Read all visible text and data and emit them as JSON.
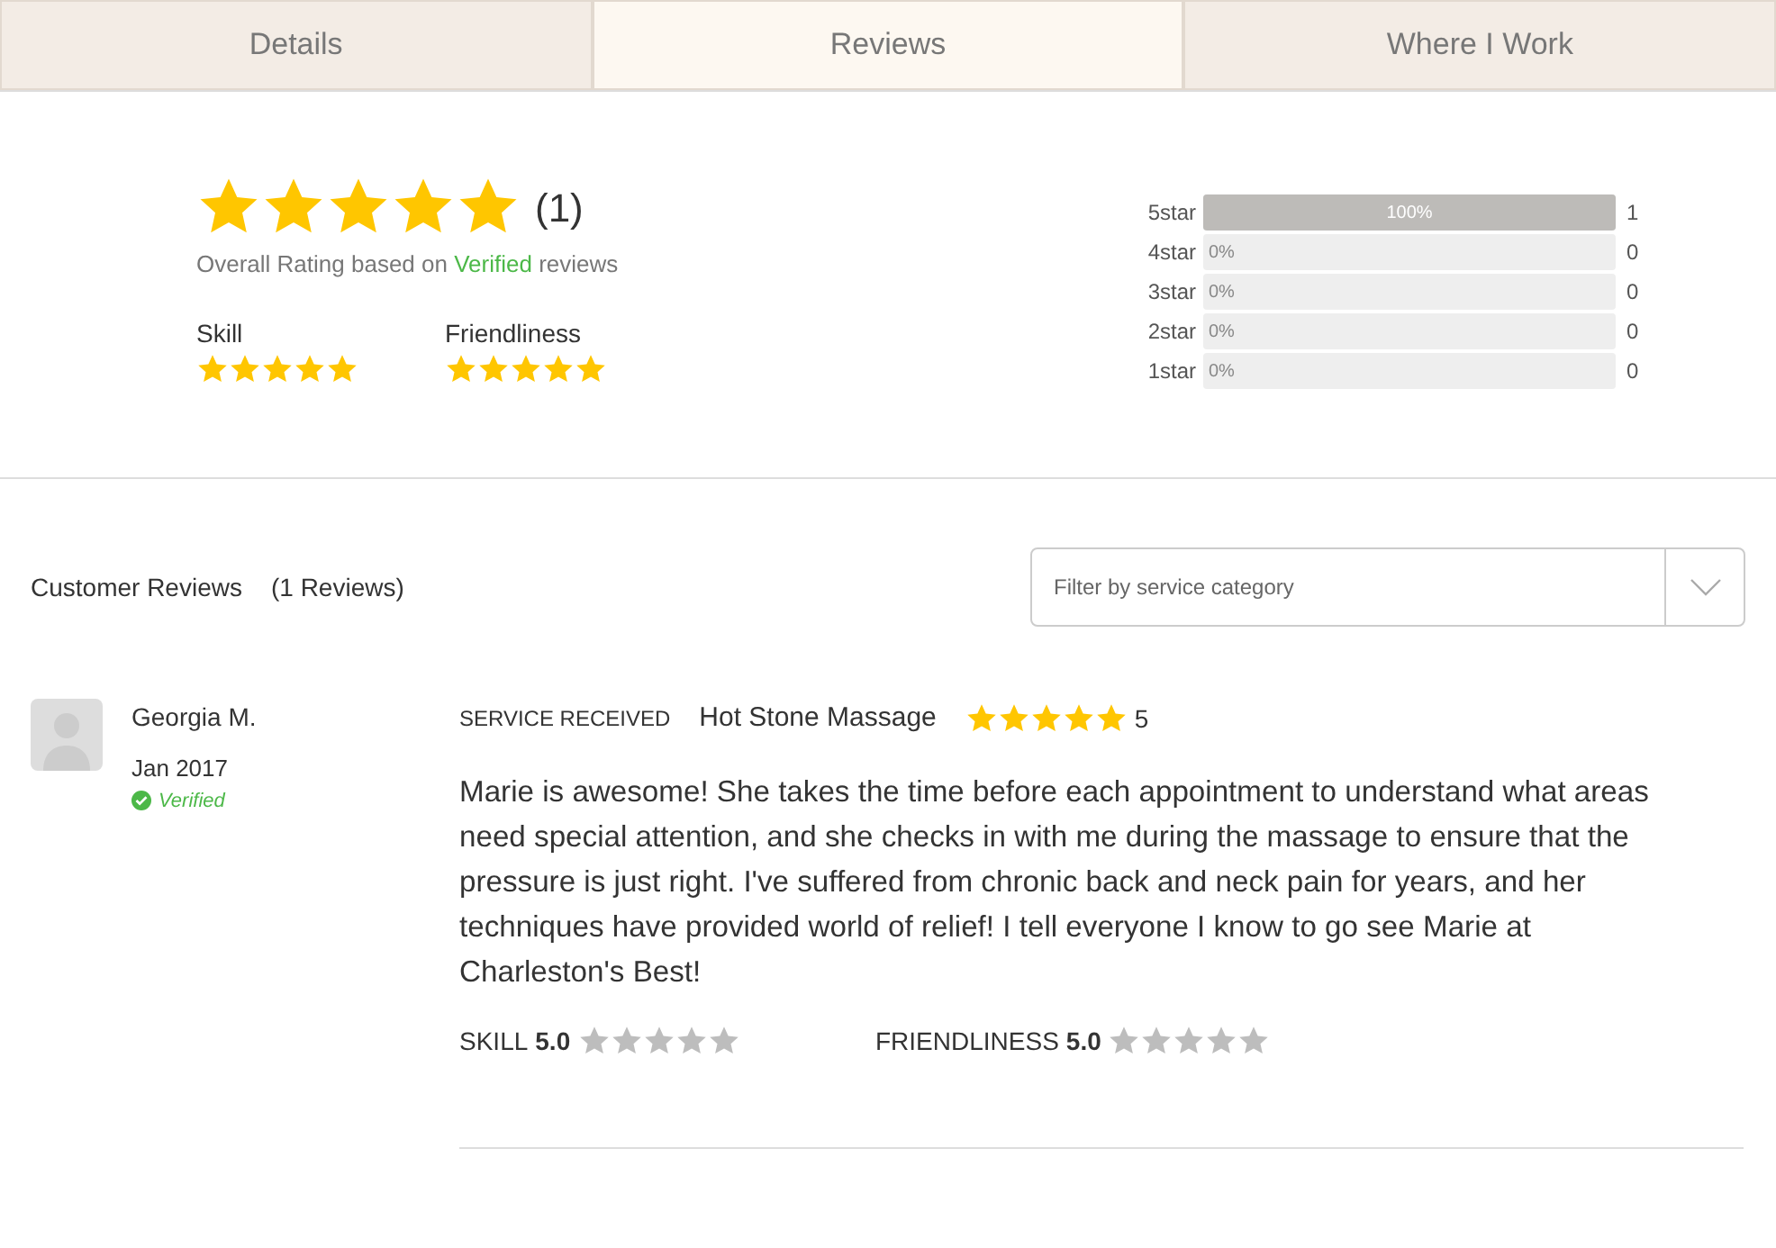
{
  "tabs": [
    {
      "label": "Details",
      "selected": false
    },
    {
      "label": "Reviews",
      "selected": true
    },
    {
      "label": "Where I Work",
      "selected": false
    }
  ],
  "summary": {
    "stars": 5,
    "count": "(1)",
    "note": {
      "prefix": "Overall Rating based on",
      "highlight": "Verified",
      "suffix": "reviews"
    },
    "categories": [
      {
        "label": "Skill",
        "stars": 5
      },
      {
        "label": "Friendliness",
        "stars": 5
      }
    ],
    "histogram": [
      {
        "label": "5star",
        "level": 1,
        "percent": "100%",
        "count": "1"
      },
      {
        "label": "4star",
        "level": 0,
        "percent": "0%",
        "count": "0"
      },
      {
        "label": "3star",
        "level": 0,
        "percent": "0%",
        "count": "0"
      },
      {
        "label": "2star",
        "level": 0,
        "percent": "0%",
        "count": "0"
      },
      {
        "label": "1star",
        "level": 0,
        "percent": "0%",
        "count": "0"
      }
    ]
  },
  "reviews_header": {
    "title": "Customer Reviews",
    "count": "(1 Reviews)",
    "filter": {
      "placeholder": "Filter by service category"
    }
  },
  "reviews": [
    {
      "name": "Georgia M.",
      "date": "Jan 2017",
      "verified": true,
      "verified_label": "Verified",
      "service_label": "SERVICE RECEIVED",
      "service": "Hot Stone Massage",
      "stars": 5,
      "score": "5",
      "text": "Marie is awesome! She takes the time before each appointment to understand what areas need special attention, and she checks in with me during the massage to ensure that the pressure is just right. I've suffered from chronic back and neck pain for years, and her techniques have provided world of relief! I tell everyone I know to go see Marie at Charleston's Best!",
      "ratings": [
        {
          "label": "SKILL",
          "score": "5.0",
          "stars": 0
        },
        {
          "label": "FRIENDLINESS",
          "score": "5.0",
          "stars": 0
        }
      ]
    }
  ]
}
